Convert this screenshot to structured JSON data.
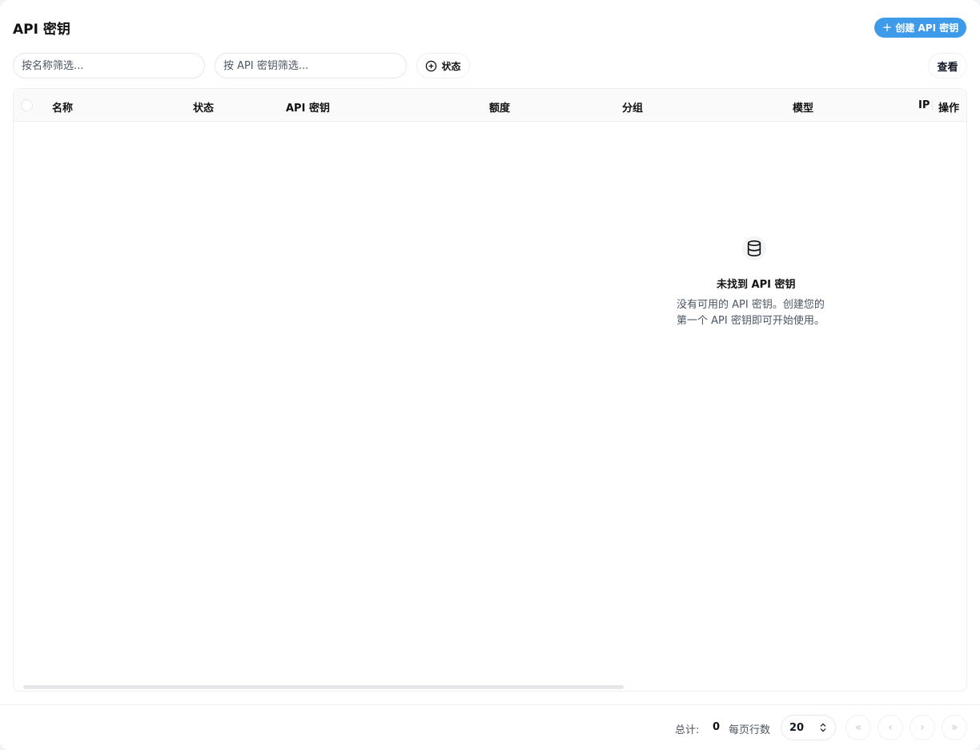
{
  "header": {
    "title": "API 密钥",
    "create_label": "创建 API 密钥"
  },
  "filters": {
    "name_placeholder": "按名称筛选...",
    "key_placeholder": "按 API 密钥筛选...",
    "status_label": "状态",
    "view_label": "查看"
  },
  "table": {
    "columns": [
      "名称",
      "状态",
      "API 密钥",
      "额度",
      "分组",
      "模型",
      "IP",
      "操作"
    ],
    "rows": []
  },
  "empty": {
    "title": "未找到 API 密钥",
    "desc_line1": "没有可用的 API 密钥。创建您的",
    "desc_line2": "第一个 API 密钥即可开始使用。"
  },
  "footer": {
    "total_label": "总计:",
    "total_value": "0",
    "rows_per_page_label": "每页行数",
    "rows_per_page": "20"
  },
  "colors": {
    "accent": "#3d9be9"
  }
}
